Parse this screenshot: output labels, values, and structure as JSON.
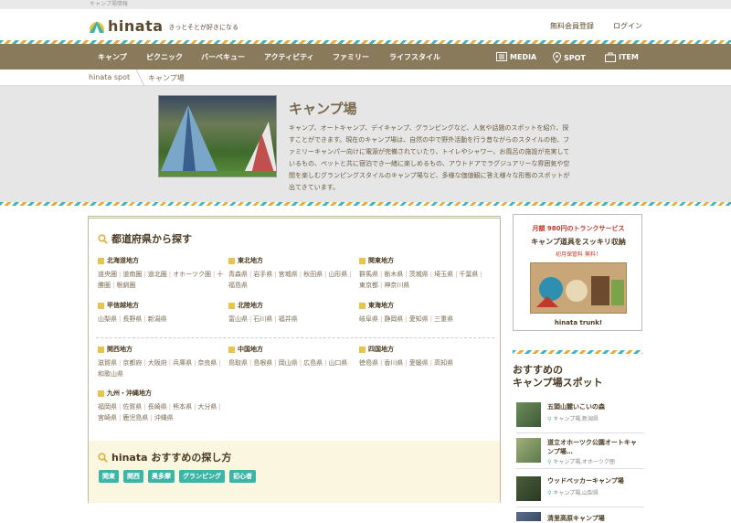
{
  "topbar": {
    "text": "キャンプ場情報"
  },
  "header": {
    "logo_text": "hinata",
    "tagline": "きっとそとが好きになる",
    "signup": "無料会員登録",
    "login": "ログイン"
  },
  "nav": {
    "items": [
      "キャンプ",
      "ピクニック",
      "バーベキュー",
      "アクティビティ",
      "ファミリー",
      "ライフスタイル"
    ],
    "right": [
      "MEDIA",
      "SPOT",
      "ITEM"
    ]
  },
  "breadcrumb": {
    "home": "hinata spot",
    "current": "キャンプ場"
  },
  "hero": {
    "title": "キャンプ場",
    "description": "キャンプ、オートキャンプ、デイキャンプ、グランピングなど、人気や話題のスポットを紹介、探すことができます。現在のキャンプ場は、自然の中で野外活動を行う昔ながらのスタイルの他、ファミリーキャンパー向けに電源が完備されていたり、トイレやシャワー、お風呂の施設が充実しているもの、ペットと共に宿泊でき一緒に楽しめるもの、アウトドアでラグジュアリーな雰囲気や空間を楽しむグランピングスタイルのキャンプ場など、多様な価値観に答え様々な形態のスポットが出てきています。"
  },
  "prefecture": {
    "title": "都道府県から探す",
    "regions": [
      {
        "name": "北海道地方",
        "prefs": [
          "道央圏",
          "道南圏",
          "道北圏",
          "オホーツク圏",
          "十勝圏",
          "根釧圏"
        ]
      },
      {
        "name": "東北地方",
        "prefs": [
          "青森県",
          "岩手県",
          "宮城県",
          "秋田県",
          "山形県",
          "福島県"
        ]
      },
      {
        "name": "関東地方",
        "prefs": [
          "群馬県",
          "栃木県",
          "茨城県",
          "埼玉県",
          "千葉県",
          "東京都",
          "神奈川県"
        ]
      },
      {
        "name": "甲信越地方",
        "prefs": [
          "山梨県",
          "長野県",
          "新潟県"
        ]
      },
      {
        "name": "北陸地方",
        "prefs": [
          "富山県",
          "石川県",
          "福井県"
        ]
      },
      {
        "name": "東海地方",
        "prefs": [
          "岐阜県",
          "静岡県",
          "愛知県",
          "三重県"
        ]
      },
      {
        "name": "関西地方",
        "prefs": [
          "滋賀県",
          "京都府",
          "大阪府",
          "兵庫県",
          "奈良県",
          "和歌山県"
        ]
      },
      {
        "name": "中国地方",
        "prefs": [
          "鳥取県",
          "島根県",
          "岡山県",
          "広島県",
          "山口県"
        ]
      },
      {
        "name": "四国地方",
        "prefs": [
          "徳島県",
          "香川県",
          "愛媛県",
          "高知県"
        ]
      },
      {
        "name": "九州・沖縄地方",
        "prefs": [
          "福岡県",
          "佐賀県",
          "長崎県",
          "熊本県",
          "大分県",
          "宮崎県",
          "鹿児島県",
          "沖縄県"
        ]
      }
    ]
  },
  "recommend": {
    "title": "hinata おすすめの探し方",
    "tags": [
      "関東",
      "関西",
      "奥多摩",
      "グランピング",
      "初心者"
    ]
  },
  "ad": {
    "line1": "月額 980円のトランクサービス",
    "line2": "キャンプ道具をスッキリ収納",
    "line3": "初月保管料 無料！",
    "brand": "hinata trunk!"
  },
  "sidebar": {
    "title_line1": "おすすめの",
    "title_line2": "キャンプ場スポット",
    "spots": [
      {
        "name": "五頭山麓いこいの森",
        "loc": "キャンプ場,新潟県"
      },
      {
        "name": "道立オホーツク公園オートキャンプ場…",
        "loc": "キャンプ場,オホーツク圏"
      },
      {
        "name": "ウッドペッカーキャンプ場",
        "loc": "キャンプ場,山梨県"
      },
      {
        "name": "清里高原キャンプ場",
        "loc": ""
      }
    ]
  },
  "colors": {
    "nav_bg": "#8a7a5c",
    "accent_teal": "#3cb5a6",
    "accent_yellow": "#e8c54a"
  }
}
